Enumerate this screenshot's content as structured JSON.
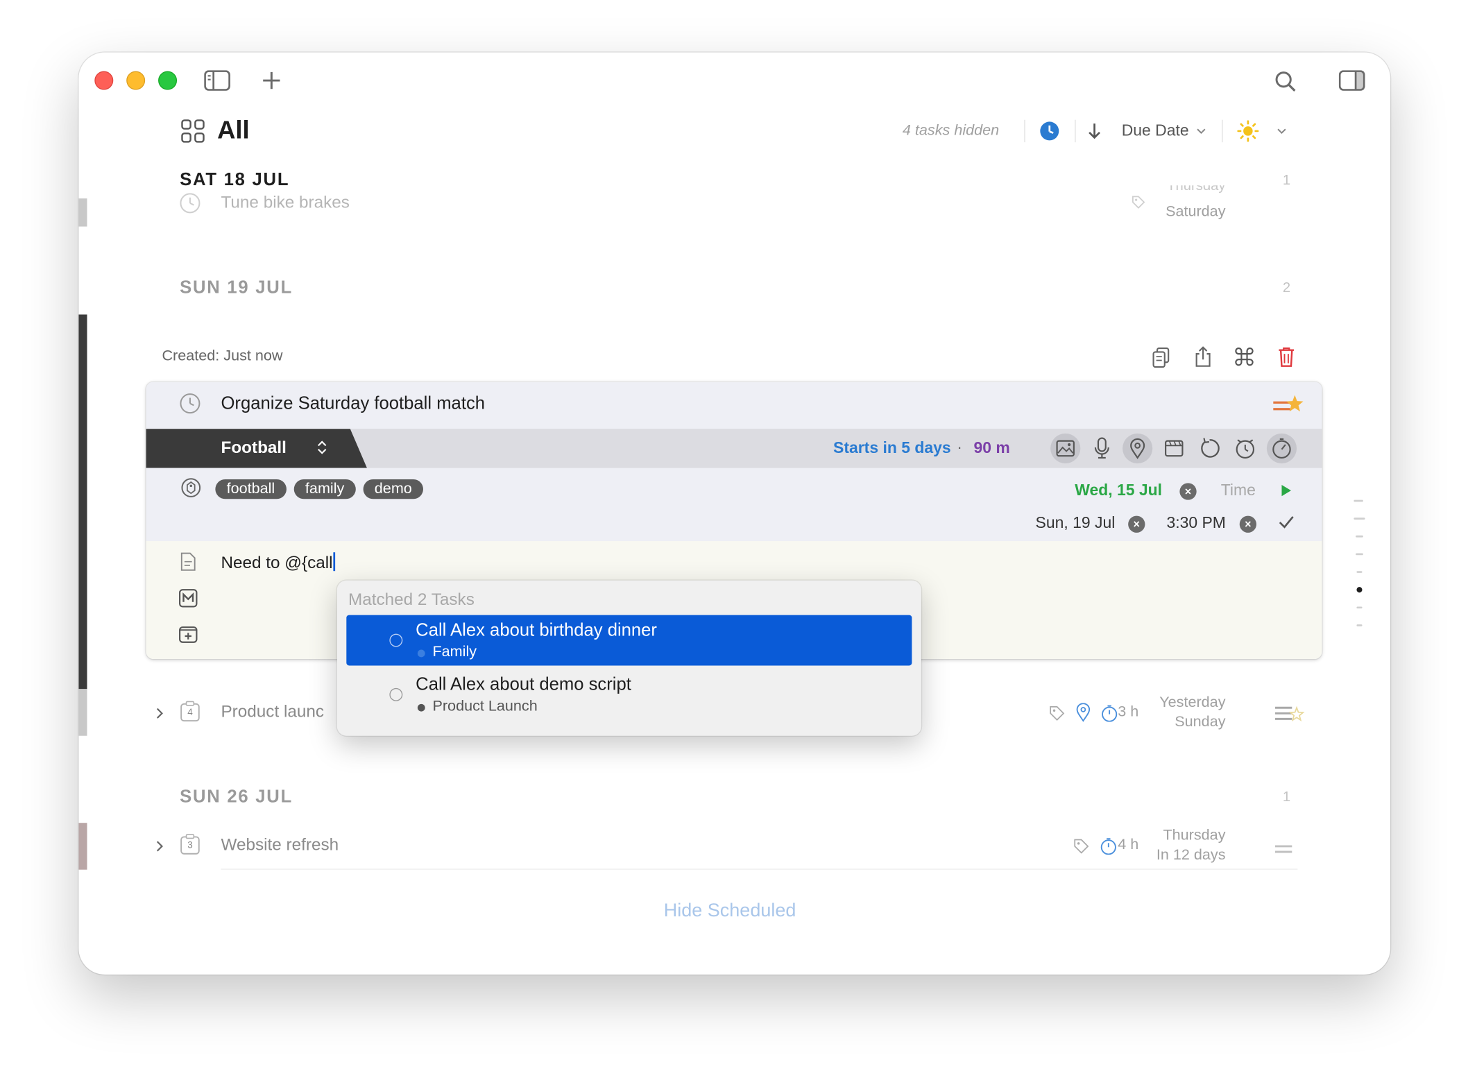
{
  "header": {
    "title": "All",
    "hidden_tasks": "4 tasks hidden",
    "sort_label": "Due Date"
  },
  "sections": [
    {
      "date": "SAT 18 JUL",
      "count": "1"
    },
    {
      "date": "SUN 19 JUL",
      "count": "2"
    },
    {
      "date": "SUN 26 JUL",
      "count": "1"
    }
  ],
  "tasks": {
    "tune": {
      "title": "Tune bike brakes",
      "date_top": "Thursday",
      "date_bottom": "Saturday"
    },
    "product": {
      "title": "Product launc",
      "badge": "4",
      "duration": "3 h",
      "date_top": "Yesterday",
      "date_bottom": "Sunday"
    },
    "website": {
      "title": "Website refresh",
      "badge": "3",
      "duration": "4 h",
      "date_top": "Thursday",
      "date_bottom": "In 12 days"
    }
  },
  "detail": {
    "created": "Created: Just now",
    "title": "Organize Saturday football match",
    "project": "Football",
    "starts": "Starts in 5 days",
    "dot": "·",
    "duration": "90 m",
    "tags": [
      "football",
      "family",
      "demo"
    ],
    "start_date": "Wed, 15 Jul",
    "time_placeholder": "Time",
    "due_date": "Sun, 19 Jul",
    "due_time": "3:30 PM",
    "note": "Need to @{call"
  },
  "autocomplete": {
    "header": "Matched 2 Tasks",
    "items": [
      {
        "title": "Call Alex about birthday dinner",
        "project": "Family"
      },
      {
        "title": "Call Alex about demo script",
        "project": "Product Launch"
      }
    ]
  },
  "footer": {
    "hide_scheduled": "Hide Scheduled"
  },
  "colors": {
    "accent_blue": "#0a5bd7",
    "start_green": "#2aa745",
    "starts_blue": "#2a7bd1",
    "duration_purple": "#7b3fa8",
    "delete_red": "#e0393e",
    "flag_yellow": "#f4b43a"
  },
  "icons": [
    "sidebar-toggle-icon",
    "plus-icon",
    "search-icon",
    "inspector-icon",
    "grid-icon",
    "clock-icon",
    "arrow-down-icon",
    "sun-icon",
    "chevron-down-icon",
    "copy-icon",
    "share-icon",
    "command-icon",
    "trash-icon",
    "priority-star-icon",
    "image-icon",
    "microphone-icon",
    "location-icon",
    "calendar-icon",
    "repeat-icon",
    "alarm-icon",
    "timer-icon",
    "tag-icon",
    "play-icon",
    "checkmark-icon",
    "note-icon",
    "markdown-icon",
    "add-checklist-icon",
    "chevron-right-icon"
  ]
}
